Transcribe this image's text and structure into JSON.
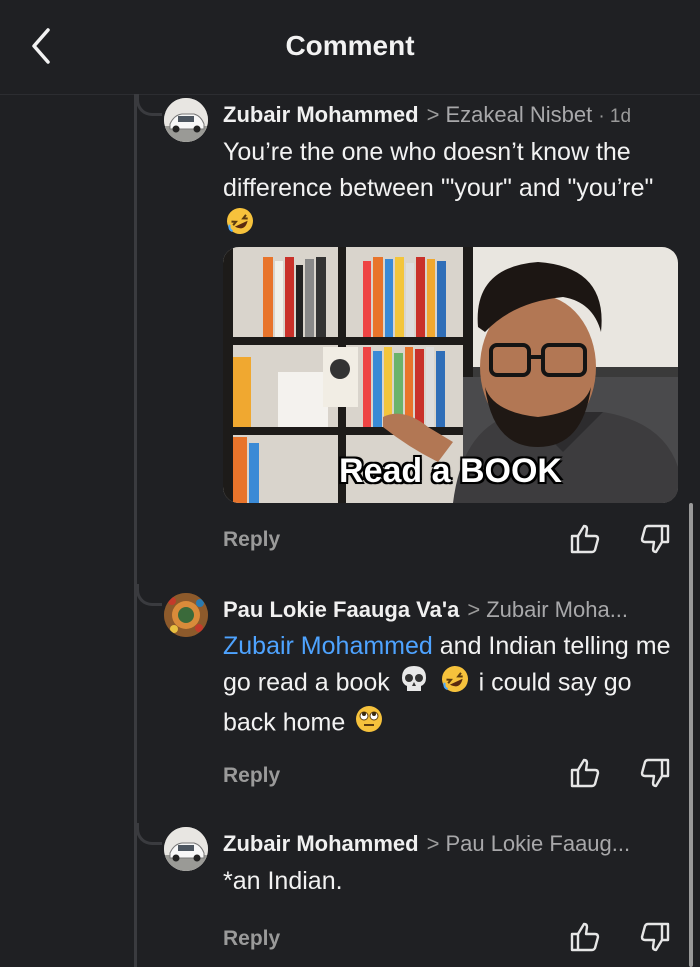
{
  "header": {
    "title": "Comment",
    "back_icon": "chevron-left-icon"
  },
  "colors": {
    "background": "#1f2023",
    "mention": "#4ea3ff",
    "muted": "#9a9a9a"
  },
  "comments": [
    {
      "author": "Zubair Mohammed",
      "reply_to": "Ezakeal Nisbet",
      "time": "· 1d",
      "text": "You’re the one who doesn’t know the difference between '\"your\" and \"you’re\"",
      "emojis": [
        "rolling-on-floor-laughing-emoji"
      ],
      "gif_caption": "Read a BOOK",
      "reply_label": "Reply"
    },
    {
      "author": "Pau Lokie Faauga Va'a",
      "reply_to": "Zubair Moha...",
      "mention": "Zubair Mohammed",
      "text_1": " and Indian telling me go read a book ",
      "text_2": " i could say go back home ",
      "emojis": [
        "skull-emoji",
        "rolling-on-floor-laughing-emoji",
        "face-with-rolling-eyes-emoji"
      ],
      "reply_label": "Reply"
    },
    {
      "author": "Zubair Mohammed",
      "reply_to": "Pau Lokie Faaug...",
      "text": "*an Indian.",
      "reply_label": "Reply"
    }
  ]
}
